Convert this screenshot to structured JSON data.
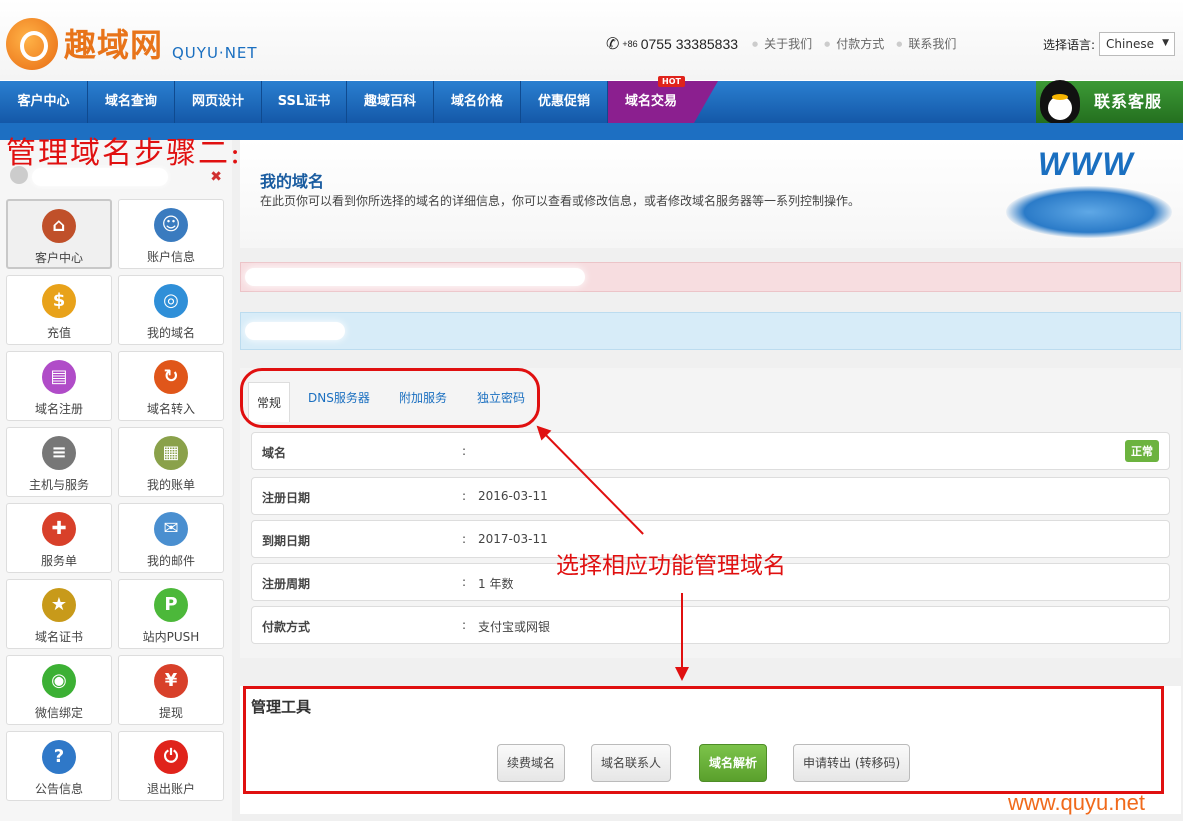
{
  "brand": {
    "name_cn": "趣域网",
    "name_en": "QUYU·NET"
  },
  "header": {
    "phone_prefix": "+86",
    "phone_number": "0755 33385833",
    "links": [
      "关于我们",
      "付款方式",
      "联系我们"
    ],
    "language_label": "选择语言:",
    "language_value": "Chinese"
  },
  "nav": {
    "items": [
      "客户中心",
      "域名查询",
      "网页设计",
      "SSL证书",
      "趣域百科",
      "域名价格",
      "优惠促销",
      "域名交易"
    ],
    "hot_badge": "HOT",
    "service_label": "联系客服"
  },
  "annotations": {
    "step_title": "管理域名步骤二:",
    "hint": "选择相应功能管理域名",
    "watermark": "www.quyu.net"
  },
  "sidebar": {
    "tiles": [
      {
        "label": "客户中心",
        "icon": "home-icon",
        "glyph": "⌂",
        "color": "#c0502a"
      },
      {
        "label": "账户信息",
        "icon": "user-icon",
        "glyph": "☺",
        "color": "#3a7bbf"
      },
      {
        "label": "充值",
        "icon": "coins-icon",
        "glyph": "$",
        "color": "#e8a21a"
      },
      {
        "label": "我的域名",
        "icon": "globe-icon",
        "glyph": "◎",
        "color": "#2f8fd8"
      },
      {
        "label": "域名注册",
        "icon": "cart-icon",
        "glyph": "▤",
        "color": "#b04cc8"
      },
      {
        "label": "域名转入",
        "icon": "transfer-icon",
        "glyph": "↻",
        "color": "#e0561a"
      },
      {
        "label": "主机与服务",
        "icon": "server-icon",
        "glyph": "≡",
        "color": "#777777"
      },
      {
        "label": "我的账单",
        "icon": "invoice-icon",
        "glyph": "▦",
        "color": "#8aa14a"
      },
      {
        "label": "服务单",
        "icon": "lifebuoy-icon",
        "glyph": "✚",
        "color": "#d8402a"
      },
      {
        "label": "我的邮件",
        "icon": "mail-icon",
        "glyph": "✉",
        "color": "#4a8fd0"
      },
      {
        "label": "域名证书",
        "icon": "certificate-icon",
        "glyph": "★",
        "color": "#c89a1a"
      },
      {
        "label": "站内PUSH",
        "icon": "push-icon",
        "glyph": "P",
        "color": "#4cb83a"
      },
      {
        "label": "微信绑定",
        "icon": "wechat-icon",
        "glyph": "◉",
        "color": "#3cb034"
      },
      {
        "label": "提现",
        "icon": "cash-icon",
        "glyph": "¥",
        "color": "#d8402a"
      },
      {
        "label": "公告信息",
        "icon": "help-icon",
        "glyph": "?",
        "color": "#2f78c8"
      },
      {
        "label": "退出账户",
        "icon": "power-icon",
        "glyph": "⏻",
        "color": "#e0231b"
      }
    ]
  },
  "page": {
    "title": "我的域名",
    "description": "在此页你可以看到你所选择的域名的详细信息，你可以查看或修改信息，或者修改域名服务器等一系列控制操作。"
  },
  "tabs": [
    "常规",
    "DNS服务器",
    "附加服务",
    "独立密码"
  ],
  "details": {
    "rows": [
      {
        "label": "域名",
        "value": ""
      },
      {
        "label": "注册日期",
        "value": "2016-03-11"
      },
      {
        "label": "到期日期",
        "value": "2017-03-11"
      },
      {
        "label": "注册周期",
        "value": "1 年数"
      },
      {
        "label": "付款方式",
        "value": "支付宝或网银"
      }
    ],
    "colon": ":",
    "status": "正常"
  },
  "tools": {
    "title": "管理工具",
    "buttons": [
      "续费域名",
      "域名联系人",
      "域名解析",
      "申请转出 (转移码)"
    ]
  }
}
